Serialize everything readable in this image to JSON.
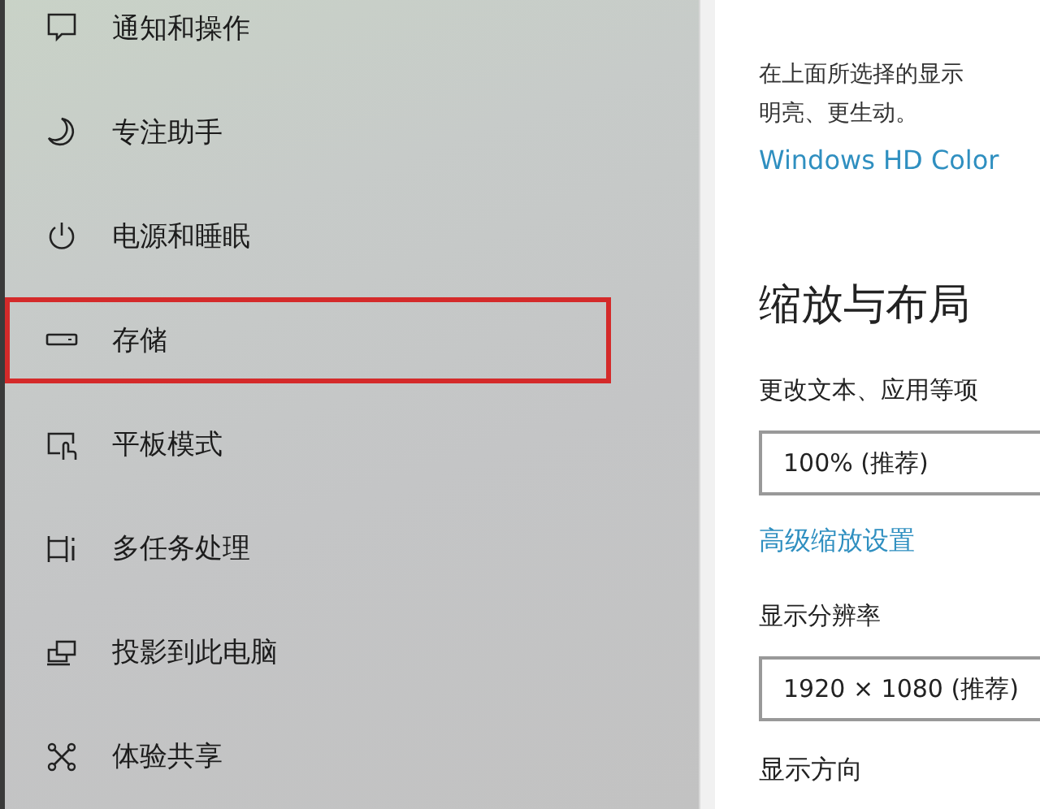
{
  "sidebar": {
    "items": [
      {
        "kind": "notifications",
        "label": "通知和操作",
        "highlighted": false
      },
      {
        "kind": "focus",
        "label": "专注助手",
        "highlighted": false
      },
      {
        "kind": "power",
        "label": "电源和睡眠",
        "highlighted": false
      },
      {
        "kind": "storage",
        "label": "存储",
        "highlighted": true
      },
      {
        "kind": "tablet",
        "label": "平板模式",
        "highlighted": false
      },
      {
        "kind": "multitasking",
        "label": "多任务处理",
        "highlighted": false
      },
      {
        "kind": "project",
        "label": "投影到此电脑",
        "highlighted": false
      },
      {
        "kind": "share",
        "label": "体验共享",
        "highlighted": false
      }
    ]
  },
  "content": {
    "description_lines": [
      "在上面所选择的显示",
      "明亮、更生动。"
    ],
    "hd_color_link": "Windows HD Color",
    "section_title": "缩放与布局",
    "scale_label": "更改文本、应用等项",
    "scale_value": "100% (推荐)",
    "advanced_scaling_link": "高级缩放设置",
    "resolution_label": "显示分辨率",
    "resolution_value": "1920 × 1080 (推荐)",
    "orientation_label": "显示方向"
  }
}
